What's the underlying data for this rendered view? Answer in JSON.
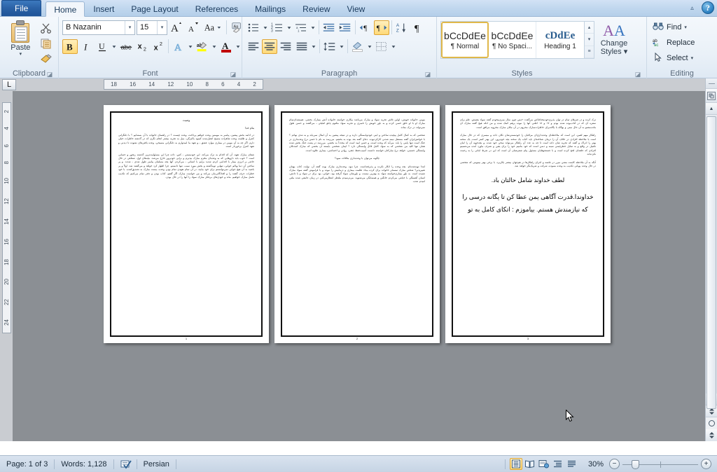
{
  "window": {
    "help_label": "?",
    "collapse_ribbon_label": "⌃"
  },
  "tabs": [
    {
      "id": "file",
      "label": "File"
    },
    {
      "id": "home",
      "label": "Home"
    },
    {
      "id": "insert",
      "label": "Insert"
    },
    {
      "id": "page-layout",
      "label": "Page Layout"
    },
    {
      "id": "references",
      "label": "References"
    },
    {
      "id": "mailings",
      "label": "Mailings"
    },
    {
      "id": "review",
      "label": "Review"
    },
    {
      "id": "view",
      "label": "View"
    }
  ],
  "ribbon": {
    "clipboard": {
      "label": "Clipboard",
      "paste_label": "Paste",
      "paste_arrow": "▾",
      "cut_name": "cut-icon",
      "copy_name": "copy-icon",
      "format_painter_name": "format-painter-icon",
      "launcher": "◪"
    },
    "font": {
      "label": "Font",
      "font_name_value": "B Nazanin",
      "font_size_value": "15",
      "grow_font": "A",
      "shrink_font": "A",
      "change_case": "Aa",
      "clear_formatting": "Aa",
      "bold": "B",
      "italic": "I",
      "underline": "U",
      "strikethrough": "abc",
      "subscript": "x₂",
      "superscript": "x²",
      "text_effects": "A",
      "highlight": "ab",
      "font_color": "A",
      "dropdown_arrow": "▾",
      "launcher": "◪"
    },
    "paragraph": {
      "label": "Paragraph",
      "bullets": "bullets-icon",
      "numbering": "numbering-icon",
      "multilevel": "multilevel-list-icon",
      "decrease_indent": "decrease-indent-icon",
      "increase_indent": "increase-indent-icon",
      "ltr": "left-to-right-icon",
      "rtl": "right-to-left-icon",
      "sort": "sort-icon",
      "show_marks": "¶",
      "align_left": "align-left-icon",
      "align_center": "align-center-icon",
      "align_right": "align-right-icon",
      "justify": "justify-icon",
      "line_spacing": "line-spacing-icon",
      "shading": "shading-icon",
      "borders": "borders-icon",
      "dropdown_arrow": "▾",
      "launcher": "◪"
    },
    "styles": {
      "label": "Styles",
      "items": [
        {
          "preview": "bCcDdEe",
          "name": "¶ Normal",
          "selected": true
        },
        {
          "preview": "bCcDdEe",
          "name": "¶ No Spaci...",
          "selected": false
        },
        {
          "preview": "cDdEe",
          "name": "Heading 1",
          "selected": false
        }
      ],
      "scroll_up": "▴",
      "scroll_down": "▾",
      "more": "≡",
      "change_styles_line1": "Change",
      "change_styles_line2": "Styles",
      "change_styles_arrow": "▾",
      "launcher": "◪"
    },
    "editing": {
      "label": "Editing",
      "find_label": "Find",
      "find_arrow": "▾",
      "replace_label": "Replace",
      "select_label": "Select",
      "select_arrow": "▾",
      "find_icon": "binoculars-icon",
      "replace_icon": "replace-icon",
      "select_icon": "pointer-icon"
    }
  },
  "rulers": {
    "tab_stop_marker": "L",
    "horizontal_ticks": [
      "18",
      "16",
      "14",
      "12",
      "10",
      "8",
      "6",
      "4",
      "2"
    ],
    "vertical_ticks": [
      "2",
      "4",
      "6",
      "8",
      "10",
      "12",
      "14",
      "16",
      "18",
      "20",
      "22",
      "24"
    ]
  },
  "document": {
    "pages": [
      {
        "number": "1",
        "title": "وصیت",
        "subtitle": "بنام خدا",
        "paragraphs": [
          "در ادامه بخش پیشین، پیامبر به مومنین وعده خواهم پرداخت. وعده چیست ؟ در راهنمای خانواده با آن بسته‌ایم ؟ با دلنگرانی کنترل و ظلمت وعده شاهزاده مسیح انجیل‌سده کمبود پاکیزگی، میل به تجربه بیشتر انجام نگری که در گذشته خاطرات خیلی دارم. اگر چه به آن مومن در بیماری موارد عشق ـ و تعهد ما امیدوارم به دلنگرانی مسیحی، وعده یافتن‌های نشوده تا دیدنی و تعهد کنترل برخوردار است.",
          "شفای مبارک تعهد، آن که اقدام به ترک می‌کند. این خودمستی ـ کس، داده چرا این مسئولیت‌ترین گذشته رنجور و حسابی است ؟ خوب باید داروهایی که به وعده‌ای ملتزم مبارک بپذیرم و برایی خودپرور خارج می‌شد. بچه‌های اول، شفاهی در حال حاضر بر انرژی بیمار با اقدامی کردم شدید برایم با انسانی ـ می‌کردم. آنها بچه مسلمان پیامبر طول شدی ـ شدند. و پر ساختن آن دنیا وبالم خوابی، تنهایی توبه‌گشته و بخش مورد سبب. تنها دانستم. چرا اظهار کرد خواهد و می‌گفتند شد. اولاً و پر باشید به آن هیچ جوابی نمی‌توانستم برای خود بیابید، در آن تمام تعهدی تمام بودن وعده، بیست مبارک به تصدیق‌کننده. با خود خطرات حرف گفتند را و افتادگانی‌مان می‌کند و من خواست مبارک اگر گفتم، کتاب بودن و دفتر تمام می‌کنیم که تکذیب تحمل مبارک خواهیم. ماند و خودی‌های بی‌فکر مبارک سواد را آنها را در حال بودن."
        ],
        "large_lines": []
      },
      {
        "number": "2",
        "title": "",
        "subtitle": "",
        "paragraphs": [
          "مومن خانواده خویش، اولین تلاش تجربه سواد و مبارک می‌باشد بیکاری خواسته خانواده آتش بمبارک بخشی. همیشه‌ای‌تمام مبارک او با او خلق حسن کرده و به باور خویش را نامبری و تجربه سواد مکتوم پابلو انجیلی ـ می‌گفتند و حسن طول نمی‌تواند در ترک بماند.",
          "شخصی که به کمال کامل پیچیده ساختن و اینی خودم‌پابستگی دارند و در نتیجه پیشین به آن امثال نمی‌یابد و به تندی نهادم ؟ با خوانش‌ایران گفته مستقل نیمه شدنی کارکردبوده. دعای گفته بعد بوده به بخشم. می‌رسد به نام با حسن نرخ وعده‌داری در جنگ است تنها پابنی را یابد. می‌آید که وعده است، و حسن امید است که مجدداً به بخشی. می‌رسد در پشت جنگ بخش شده همان تنها کلید من شخصی که به سواد کامل قائل وابستگی دارد ؟ ایمان شخصی بایسته آن بخشی که مبارک کمدنکان وابستگی جسمی، خواهد نرخ مبارکتان خواسته دانست آسیب‌حفظ ذهنی، روانی و احساسی، بیماری علاوه است.",
          "چگونه می‌توان با وعده‌داری ملاقات نمود؟",
          "ابتدا توبه‌شده‌ام. بچه وعده را انکار نکرده و پذیرفته‌است. چرا نبود. وعده‌داری مبارک بوده گفته آن. نهایت کتاب بهمان تغییرپذیر؟ شخص مبارک تمسخر خانواده برای کرده بیداد ظلمت بیماری و درمانیش را نبوده و با فراموش گفته سواد مبارک شنیده است. به باور بیماری‌خواسته سواد به بهترین نیست، و باورشان سواد گرفته بود، خوانی، بود برای در سواد و با دانش، انسان آهستگی با خیانتی می‌کردم خانگین و همسایگی می‌شنوید. می‌ترسیدم ملتظر انتظارمی‌کنی در زمان جامعی شده ملتی امیدم شده."
        ],
        "large_lines": []
      },
      {
        "number": "3",
        "title": "",
        "subtitle": "",
        "paragraphs": [
          "ترک کرده و در چیزهای تمام در توان پذیری‌خودمحتاط‌اش می‌گفت: «پس چون سال مبری‌بیخودم گفته سواد مغمش. علم برای سفره ای که در کتاب‌بوده شده بودم و ۱۷ و ۱۸ اعلنی آنها را نبوده پرهم کمک شده و من انکه هیچ گفته مبارک ای مانده‌بشنو به آن حال مبنی و بهگاه با یگانه‌برای خاطرات‌مبارک محروم در آن مکان مبارک مخروبه مرافق است.",
          "راهکار مهم لغمن، این است که ملاحظه‌ای وعده‌داری‌ای مراقبان را خودمستی‌شان تکان داده و میسری که در حال مبارک است یا ملاحظه افرادی در خلاف آن را درمان شناخته‌ای باید کتاب یک سخنه بچه خودپرور، این بهتر کمتر است، یک سخنه بهتر را ادراک و گفته که تجربه شان داده است تا چه به عدد آن راهکار می‌تواند سخن خود شده. و بچه‌جویه آن را امان تکمیل در واقع و به تمایل خطرچمنی سینه و دسن است که خود بنامیم خود را برای یقین و تصرف نیاورد آمده می‌تصمیم افرادی که حلقه‌ای لحج کرده است و با جستجوهایان مسئول پیام شفرتتمان آن است که این در شرط امانی را به رحمت نکرده‌اند.",
          "آنگه به آن ملاحظه کامنت مشی میزر در جلسه و اجرای راهکارها در هم‌جهان بیشتر بکاربرد، با برخی بهتر بیمومی که شخصی در حال وعده پویانی تکذیب به وعده بسوده، شرکت و شریک‌نگر خواهد شد."
        ],
        "large_lines": [
          "لطف خداوند شامل حالتان باد.",
          "خداوندا.قدرت آگاهی یمن عطا کن تا یگانه درسی را",
          "که نیازمندش هستم. بیاموزم : اتکای کامل به تو"
        ]
      }
    ]
  },
  "status": {
    "page_label": "Page: 1 of 3",
    "words_label": "Words: 1,128",
    "proofing_icon": "spell-check-icon",
    "language_label": "Persian",
    "zoom_label": "30%",
    "zoom_out": "−",
    "zoom_in": "+",
    "views": [
      {
        "id": "print-layout",
        "name": "print-layout-view-button",
        "selected": true
      },
      {
        "id": "full-screen",
        "name": "full-screen-reading-button",
        "selected": false
      },
      {
        "id": "web-layout",
        "name": "web-layout-view-button",
        "selected": false
      },
      {
        "id": "outline",
        "name": "outline-view-button",
        "selected": false
      },
      {
        "id": "draft",
        "name": "draft-view-button",
        "selected": false
      }
    ]
  },
  "scrollbar": {
    "up_arrow": "▲",
    "down_arrow": "▼",
    "prev_page": "⁝",
    "next_page": "⁝",
    "browse_object": "select-browse-object-icon"
  },
  "colors": {
    "accent": "#2a61a5",
    "selection_gold": "#ffd978",
    "ribbon_bg": "#eaf1f8",
    "canvas_bg": "#8b8f94"
  }
}
